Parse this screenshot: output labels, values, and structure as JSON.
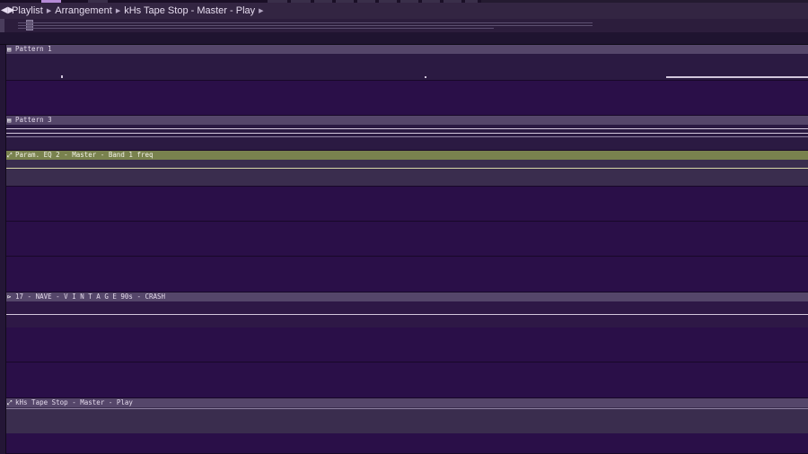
{
  "titlebar": {
    "crumbs": [
      "Playlist",
      "Arrangement",
      "kHs Tape Stop - Master - Play"
    ]
  },
  "clips": [
    {
      "label": "Pattern 1",
      "icon": "pattern-icon"
    },
    {
      "label": "Pattern 3",
      "icon": "pattern-icon"
    },
    {
      "label": "Param. EQ 2 - Master - Band 1 freq",
      "icon": "automation-icon",
      "color": "#79824e"
    },
    {
      "label": "17 - NAVE - V I N T A G E 90s - CRASH",
      "icon": "audio-clip-icon"
    },
    {
      "label": "kHs Tape Stop - Master - Play",
      "icon": "automation-icon"
    }
  ],
  "colors": {
    "lane_background": "#2a0f48",
    "clip_header": "#55466a",
    "automation_clip_header": "#79824e"
  }
}
